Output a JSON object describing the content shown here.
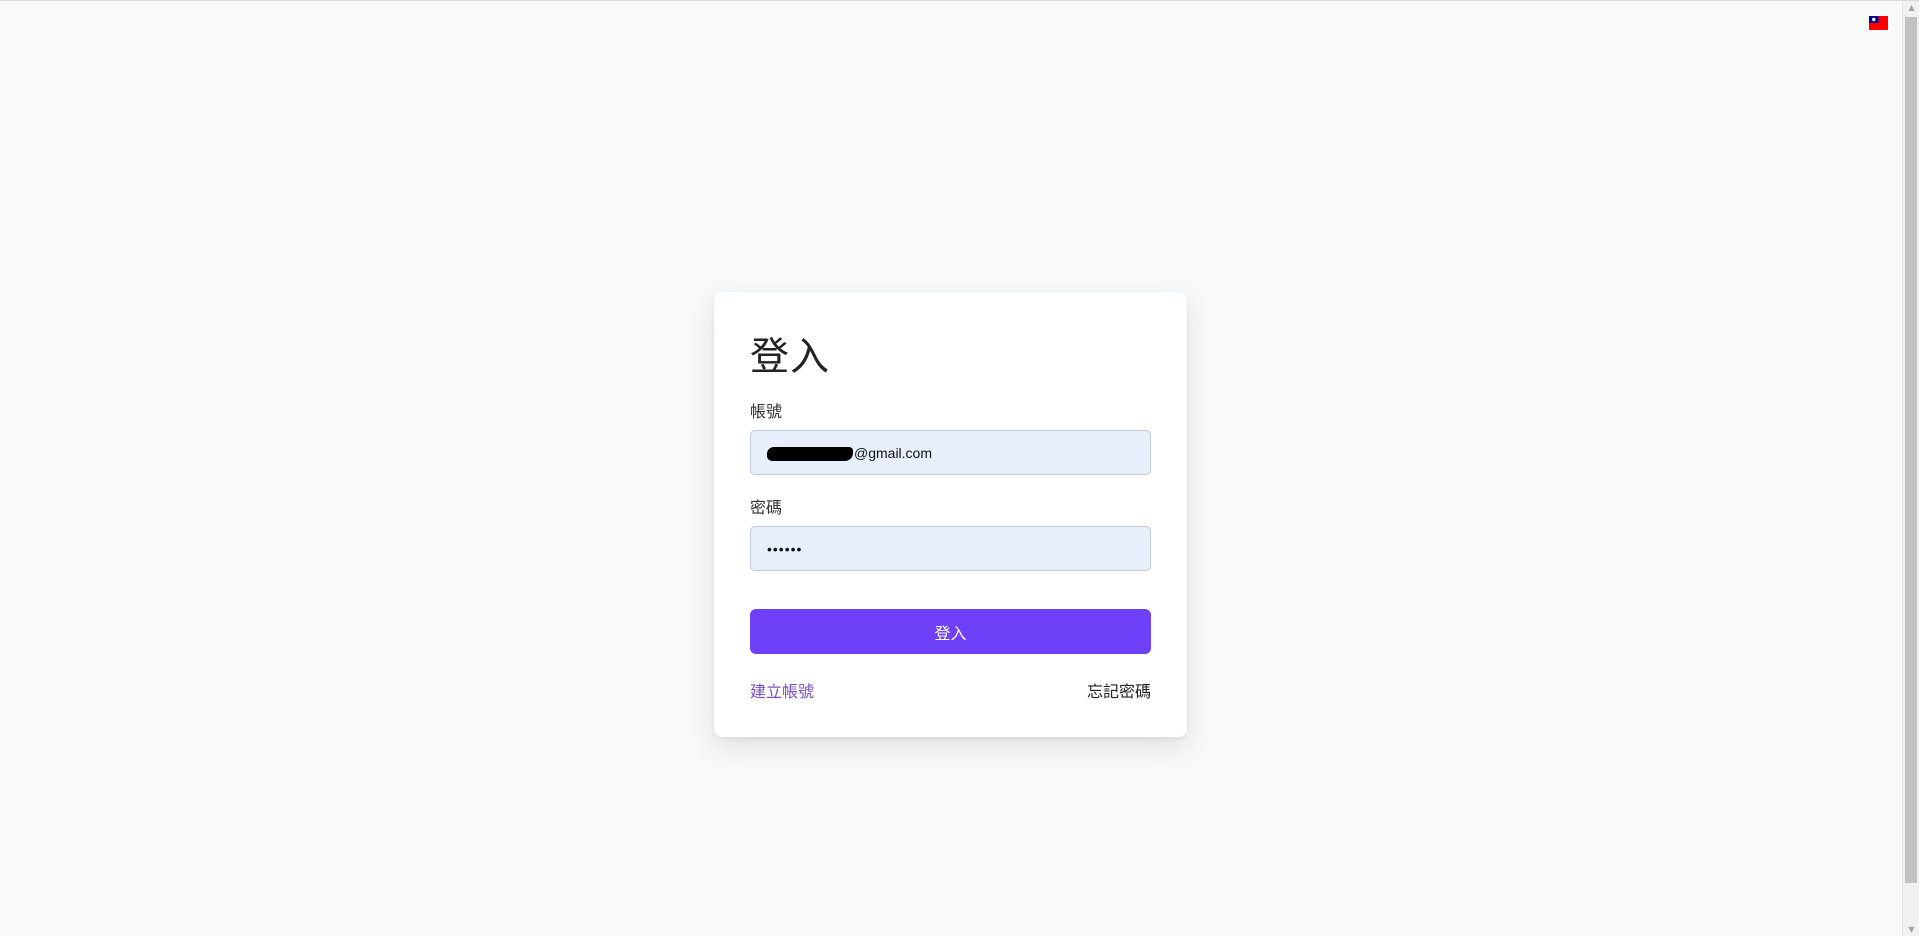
{
  "language": {
    "flag_icon": "taiwan-flag-icon",
    "flag_colors": {
      "red": "#fe0000",
      "blue": "#000095",
      "white": "#ffffff"
    }
  },
  "login": {
    "title": "登入",
    "account_label": "帳號",
    "account_value_visible": "@gmail.com",
    "password_label": "密碼",
    "password_value": "••••••",
    "submit_label": "登入",
    "create_account_link": "建立帳號",
    "forgot_password_link": "忘記密碼"
  },
  "colors": {
    "page_background": "#f8f9fb",
    "input_background": "#e8effc",
    "primary_button": "#6e40f7",
    "create_link": "#7b4fc9"
  }
}
